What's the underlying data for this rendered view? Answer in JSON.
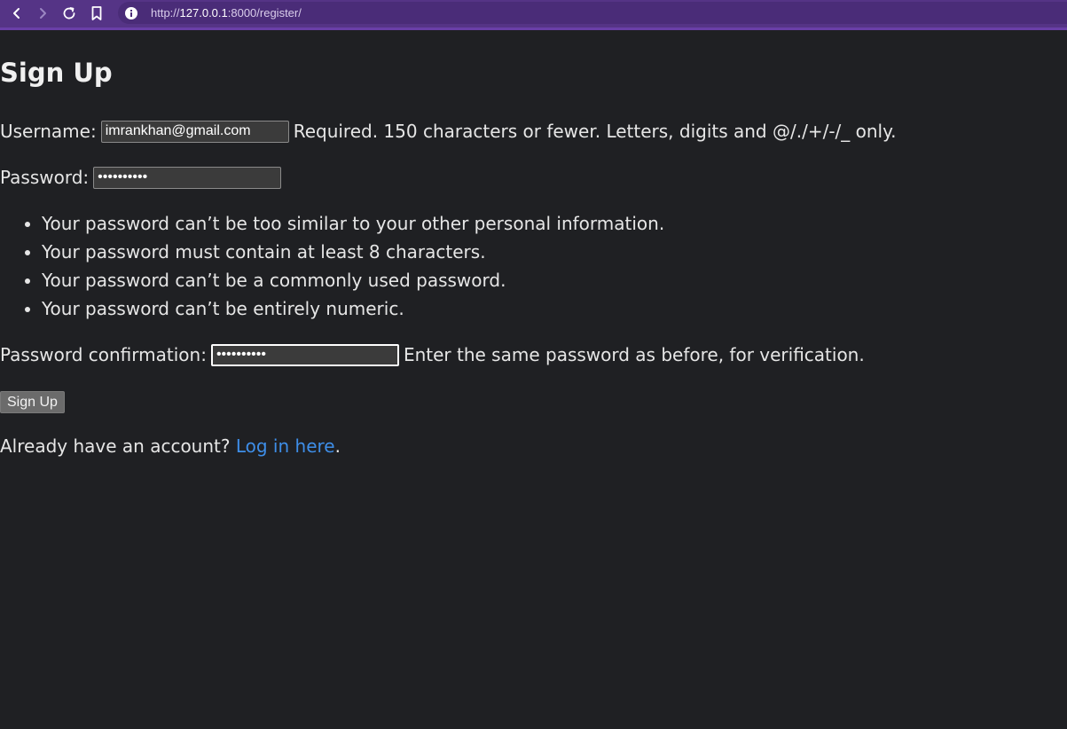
{
  "browser": {
    "url_host": "127.0.0.1",
    "url_path": ":8000/register/",
    "url_scheme": "http://",
    "back_icon": "chevron-left-icon",
    "forward_icon": "chevron-right-icon",
    "reload_icon": "reload-icon",
    "bookmark_icon": "bookmark-icon",
    "info_icon": "info-icon"
  },
  "page": {
    "title": "Sign Up",
    "username": {
      "label": "Username:",
      "value": "imrankhan@gmail.com",
      "help": "Required. 150 characters or fewer. Letters, digits and @/./+/-/_ only."
    },
    "password": {
      "label": "Password:",
      "value": "••••••••••"
    },
    "password_rules": [
      "Your password can’t be too similar to your other personal information.",
      "Your password must contain at least 8 characters.",
      "Your password can’t be a commonly used password.",
      "Your password can’t be entirely numeric."
    ],
    "password_confirmation": {
      "label": "Password confirmation:",
      "value": "••••••••••",
      "help": "Enter the same password as before, for verification."
    },
    "submit_label": "Sign Up",
    "login_prompt": "Already have an account?",
    "login_link": "Log in here",
    "login_suffix": "."
  },
  "colors": {
    "background": "#1f2023",
    "browser_bar": "#553486",
    "link": "#3e8ee8"
  }
}
